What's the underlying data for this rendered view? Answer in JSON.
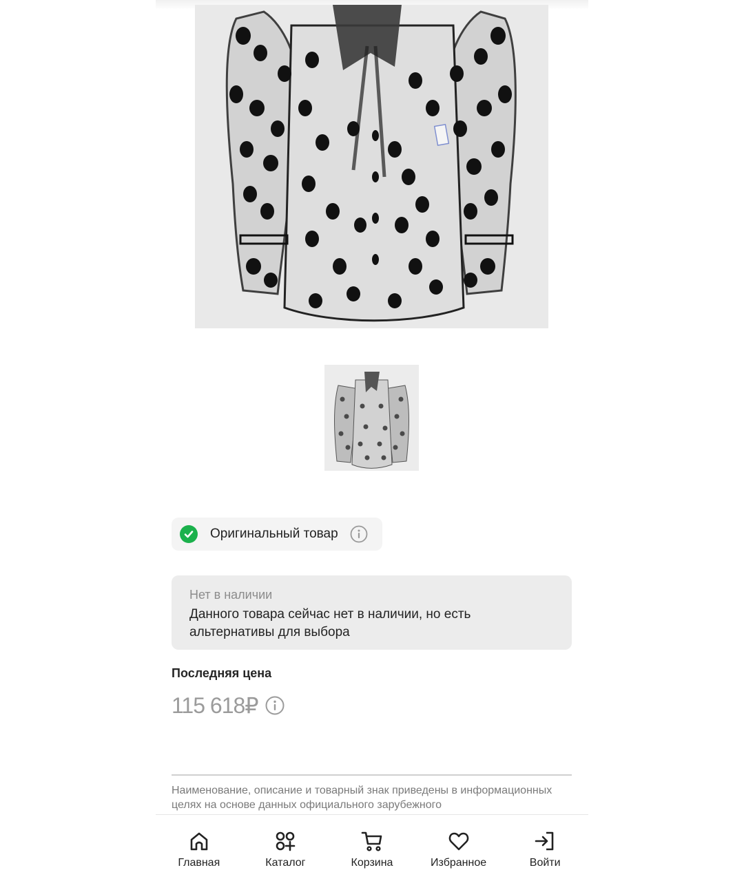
{
  "product": {
    "main_photo_alt": "sheer polka-dot blouse",
    "thumbnail_alt": "blouse thumbnail"
  },
  "badge": {
    "label": "Оригинальный товар",
    "icon": "check-circle-icon",
    "info_icon": "info-icon"
  },
  "availability": {
    "title": "Нет в наличии",
    "message": "Данного товара сейчас нет в наличии, но есть альтернативы для выбора"
  },
  "price": {
    "label": "Последняя цена",
    "value": "115 618₽",
    "info_icon": "info-icon"
  },
  "disclaimer": "Наименование, описание и товарный знак приведены в информационных целях на основе данных официального зарубежного",
  "nav": {
    "items": [
      {
        "label": "Главная",
        "icon": "home-icon"
      },
      {
        "label": "Каталог",
        "icon": "catalog-icon"
      },
      {
        "label": "Корзина",
        "icon": "cart-icon"
      },
      {
        "label": "Избранное",
        "icon": "heart-icon"
      },
      {
        "label": "Войти",
        "icon": "login-icon"
      }
    ]
  },
  "colors": {
    "accent_green": "#1bb14c",
    "price_gray": "#9b9b9b",
    "box_gray": "#ececec"
  }
}
